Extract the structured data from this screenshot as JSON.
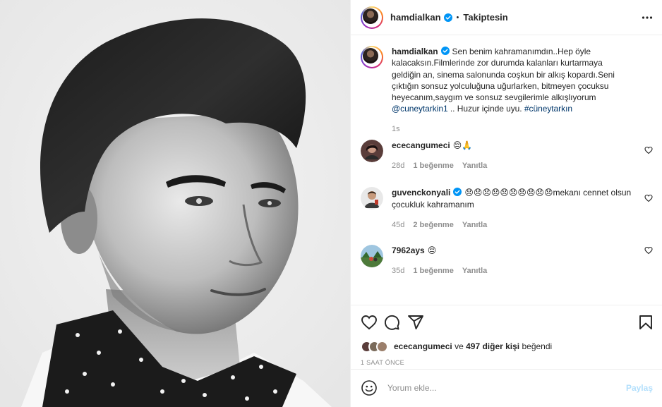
{
  "post": {
    "author": "hamdialkan",
    "follow_status": "Takiptesin",
    "separator": "•",
    "image_alt": ""
  },
  "caption": {
    "user": "hamdialkan",
    "text_1": "Sen benim kahramanımdın..Hep öyle kalacaksın.Filmlerinde zor durumda kalanları kurtarmaya geldiğin an, sinema salonunda coşkun bir alkış kopardı.Seni çıktığın sonsuz yolculuğuna uğurlarken, bitmeyen çocuksu heyecanım,saygım ve sonsuz sevgilerimle alkışlıyorum ",
    "mention": "@cuneytarkin1",
    "text_2": " .. Huzur içinde uyu. ",
    "hashtag": "#cüneytarkın",
    "time": "1s"
  },
  "comments": [
    {
      "user": "ececangumeci",
      "text": "😔🙏",
      "age": "28d",
      "likes": "1 beğenme",
      "reply": "Yanıtla",
      "verified": false
    },
    {
      "user": "guvenckonyali",
      "text": "😞😞😞😞😞😞😞😞😞😞mekanı cennet olsun çocukluk kahramanım",
      "age": "45d",
      "likes": "2 beğenme",
      "reply": "Yanıtla",
      "verified": true
    },
    {
      "user": "7962ays",
      "text": "😔",
      "age": "35d",
      "likes": "1 beğenme",
      "reply": "Yanıtla",
      "verified": false
    }
  ],
  "likes": {
    "first_user": "ececangumeci",
    "connector": "ve",
    "others": "497 diğer kişi",
    "suffix": "beğendi"
  },
  "time_ago": "1 SAAT ÖNCE",
  "add_comment": {
    "placeholder": "Yorum ekle...",
    "share_label": "Paylaş"
  },
  "colors": {
    "verified": "#0095f6",
    "link": "#00376b",
    "muted": "#8e8e8e",
    "share_disabled": "#b2dffc"
  },
  "icons": [
    "more-options-icon",
    "verified-badge-icon",
    "heart-icon",
    "comment-icon",
    "share-icon",
    "bookmark-icon",
    "emoji-icon"
  ]
}
